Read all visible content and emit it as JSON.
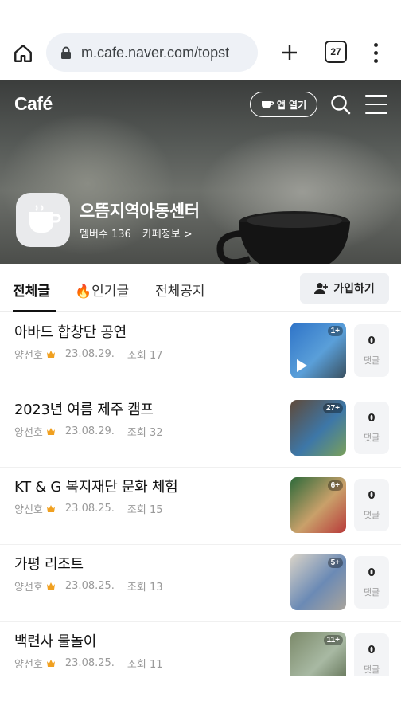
{
  "browser": {
    "url": "m.cafe.naver.com/topst",
    "tab_count": "27"
  },
  "header": {
    "logo": "Café",
    "app_open": "앱 열기"
  },
  "cafe": {
    "name": "으뜸지역아동센터",
    "members_label": "멤버수 136",
    "info_link": "카페정보 >"
  },
  "tabs": [
    {
      "label": "전체글"
    },
    {
      "label": "🔥인기글"
    },
    {
      "label": "전체공지"
    }
  ],
  "join_label": "가입하기",
  "posts": [
    {
      "title": "아바드 합창단 공연",
      "author": "양선호",
      "date": "23.08.29.",
      "views": "조회 17",
      "badge": "1+",
      "comments": "0",
      "comment_label": "댓글",
      "video": true,
      "colors": [
        "#2f74c8",
        "#5a9fd9",
        "#394f5e"
      ]
    },
    {
      "title": "2023년 여름 제주 캠프",
      "author": "양선호",
      "date": "23.08.29.",
      "views": "조회 32",
      "badge": "27+",
      "comments": "0",
      "comment_label": "댓글",
      "video": false,
      "colors": [
        "#5f4a3a",
        "#3d77a8",
        "#7aa05a"
      ]
    },
    {
      "title": "KT & G 복지재단 문화 체험",
      "author": "양선호",
      "date": "23.08.25.",
      "views": "조회 15",
      "badge": "6+",
      "comments": "0",
      "comment_label": "댓글",
      "video": false,
      "colors": [
        "#2e6a3a",
        "#c9a06a",
        "#b83a3a"
      ]
    },
    {
      "title": "가평 리조트",
      "author": "양선호",
      "date": "23.08.25.",
      "views": "조회 13",
      "badge": "5+",
      "comments": "0",
      "comment_label": "댓글",
      "video": false,
      "colors": [
        "#d9d3c8",
        "#6b8ab5",
        "#a9a49c"
      ]
    },
    {
      "title": "백련사 물놀이",
      "author": "양선호",
      "date": "23.08.25.",
      "views": "조회 11",
      "badge": "11+",
      "comments": "0",
      "comment_label": "댓글",
      "video": false,
      "colors": [
        "#7c8a6a",
        "#a8b9a3",
        "#5b6b4e"
      ]
    }
  ]
}
